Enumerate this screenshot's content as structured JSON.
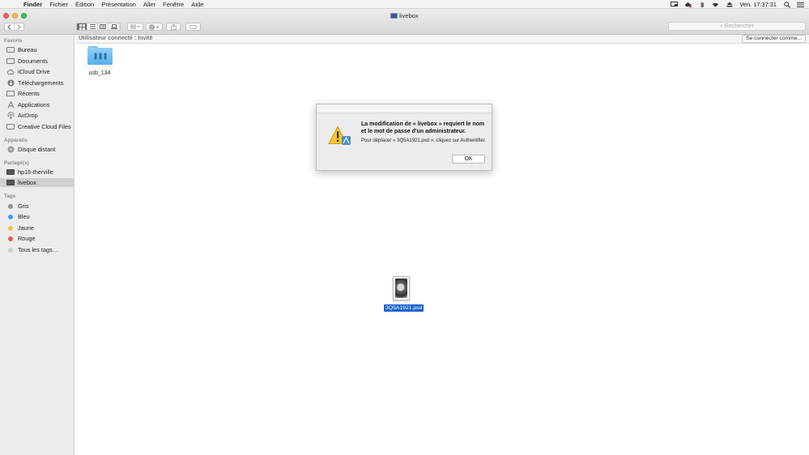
{
  "menubar": {
    "app": "Finder",
    "items": [
      "Fichier",
      "Édition",
      "Présentation",
      "Aller",
      "Fenêtre",
      "Aide"
    ],
    "clock": "Ven. 17:37:31"
  },
  "window": {
    "title": "livebox"
  },
  "toolbar": {
    "search_placeholder": "Rechercher"
  },
  "sidebar": {
    "favorites_header": "Favoris",
    "favorites": [
      {
        "label": "Bureau",
        "icon": "desktop-icon"
      },
      {
        "label": "Documents",
        "icon": "documents-icon"
      },
      {
        "label": "iCloud Drive",
        "icon": "cloud-icon"
      },
      {
        "label": "Téléchargements",
        "icon": "download-icon"
      },
      {
        "label": "Récents",
        "icon": "recents-icon"
      },
      {
        "label": "Applications",
        "icon": "applications-icon"
      },
      {
        "label": "AirDrop",
        "icon": "airdrop-icon"
      },
      {
        "label": "Creative Cloud Files",
        "icon": "folder-icon"
      }
    ],
    "devices_header": "Appareils",
    "devices": [
      {
        "label": "Disque distant",
        "icon": "disc-icon"
      }
    ],
    "shared_header": "Partagé(s)",
    "shared": [
      {
        "label": "hp16-therville",
        "icon": "display-icon"
      },
      {
        "label": "livebox",
        "icon": "display-icon",
        "selected": true
      }
    ],
    "tags_header": "Tags",
    "tags": [
      {
        "label": "Gris",
        "color": "#8e8e93"
      },
      {
        "label": "Bleu",
        "color": "#3f9ff6"
      },
      {
        "label": "Jaune",
        "color": "#f7c531"
      },
      {
        "label": "Rouge",
        "color": "#f25450"
      },
      {
        "label": "Tous les tags…",
        "color": "#cfcfcf"
      }
    ]
  },
  "pathbar": {
    "status": "Utilisateur connecté : Invité",
    "connect_label": "Se connecter comme..."
  },
  "content": {
    "folder_label": "usb_134",
    "file_label": "3Q5A1921.psd"
  },
  "dialog": {
    "title": "La modification de « livebox » requiert le nom et le mot de passe d'un administrateur.",
    "message": "Pour déplacer « 3Q5A1921.psd », cliquez sur Authentifier.",
    "ok_label": "OK"
  }
}
